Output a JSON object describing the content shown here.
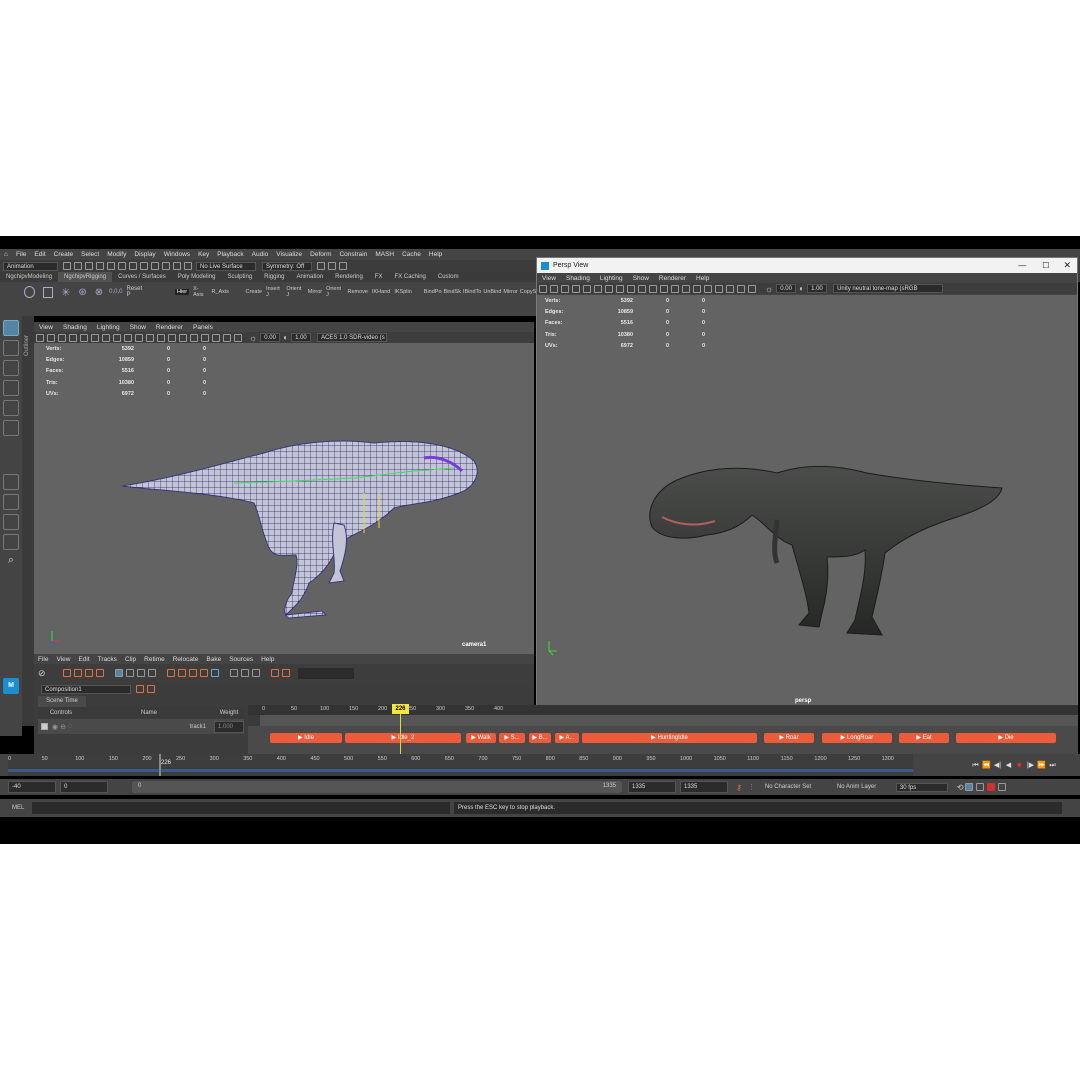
{
  "menu": {
    "items": [
      "File",
      "Edit",
      "Create",
      "Select",
      "Modify",
      "Display",
      "Windows",
      "Key",
      "Playback",
      "Audio",
      "Visualize",
      "Deform",
      "Constrain",
      "MASH",
      "Cache",
      "Help"
    ]
  },
  "status": {
    "mode": "Animation",
    "live_surface": "No Live Surface",
    "symmetry": "Symmetry: Off"
  },
  "shelf": {
    "tabs": [
      "NgchipvModeling",
      "NgchipvRigging",
      "Curves / Surfaces",
      "Poly Modeling",
      "Sculpting",
      "Rigging",
      "Animation",
      "Rendering",
      "FX",
      "FX Caching",
      "Custom"
    ],
    "active_tab": 1,
    "labels": [
      "Reset P",
      "Hier",
      "X-Axis",
      "R_Axis",
      "Create",
      "Insert J",
      "Orient J",
      "Mirror",
      "Orient J",
      "Remove",
      "IKHand",
      "IKSplin",
      "BindPo",
      "BindSk",
      "IBindTo",
      "UnBind",
      "Mirror",
      "CopySk"
    ]
  },
  "viewport_left": {
    "menus": [
      "View",
      "Shading",
      "Lighting",
      "Show",
      "Renderer",
      "Panels"
    ],
    "exposure": "0.00",
    "gamma": "1.00",
    "colorspace": "ACES 1.0 SDR-video (s",
    "camera": "camera1",
    "side_label": "Outliner"
  },
  "hud": {
    "rows": [
      {
        "k": "Verts:",
        "v": "5392",
        "a": "0",
        "b": "0"
      },
      {
        "k": "Edges:",
        "v": "10859",
        "a": "0",
        "b": "0"
      },
      {
        "k": "Faces:",
        "v": "5516",
        "a": "0",
        "b": "0"
      },
      {
        "k": "Tris:",
        "v": "10380",
        "a": "0",
        "b": "0"
      },
      {
        "k": "UVs:",
        "v": "6972",
        "a": "0",
        "b": "0"
      }
    ]
  },
  "persp_window": {
    "title": "Persp View",
    "menus": [
      "View",
      "Shading",
      "Lighting",
      "Show",
      "Renderer",
      "Help"
    ],
    "exposure": "0.00",
    "gamma": "1.00",
    "colorspace": "Unity neutral tone-map (sRGB",
    "camera": "persp",
    "ws_label": "Workspace: Animation"
  },
  "time_editor": {
    "menus": [
      "File",
      "View",
      "Edit",
      "Tracks",
      "Clip",
      "Retime",
      "Relocate",
      "Bake",
      "Sources",
      "Help"
    ],
    "side_label": "Time Editor",
    "composition": "Composition1",
    "scene_time": "Scene Time",
    "col_controls": "Controls",
    "col_name": "Name",
    "col_weight": "Weight",
    "track": "track1",
    "track_weight": "1.000",
    "current": "226",
    "ticks": [
      "0",
      "50",
      "100",
      "150",
      "200",
      "250",
      "300",
      "350",
      "400"
    ],
    "clips": [
      "Idle",
      "Idle_2",
      "Walk",
      "S...",
      "B...",
      "A...",
      "HuntingIdle",
      "Roar",
      "LongRoar",
      "Eat",
      "Die"
    ]
  },
  "timeslider": {
    "ticks": [
      "0",
      "50",
      "100",
      "150",
      "200",
      "250",
      "300",
      "350",
      "400",
      "450",
      "500",
      "550",
      "600",
      "650",
      "700",
      "750",
      "800",
      "850",
      "900",
      "950",
      "1000",
      "1050",
      "1100",
      "1150",
      "1200",
      "1250",
      "1300"
    ],
    "current": "226"
  },
  "range": {
    "start": "-40",
    "anim_start": "0",
    "slider_start": "0",
    "slider_end": "1335",
    "end": "1335",
    "anim_end": "1335",
    "char_set": "No Character Set",
    "anim_layer": "No Anim Layer",
    "fps": "30 fps"
  },
  "cmd": {
    "lang": "MEL",
    "help": "Press the ESC key to stop playback."
  }
}
